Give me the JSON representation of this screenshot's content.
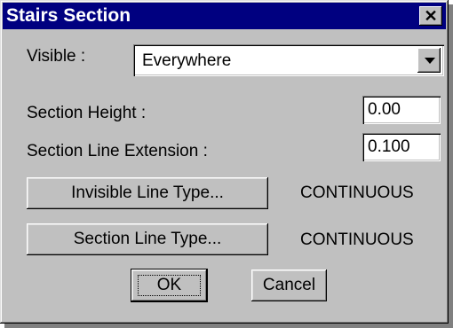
{
  "dialog": {
    "title": "Stairs Section",
    "close_glyph": "✕"
  },
  "visible": {
    "label": "Visible :",
    "value": "Everywhere"
  },
  "section_height": {
    "label": "Section Height :",
    "value": "0.00"
  },
  "section_line_extension": {
    "label": "Section Line Extension :",
    "value": "0.100"
  },
  "invisible_line_type": {
    "button_label": "Invisible Line Type...",
    "value": "CONTINUOUS"
  },
  "section_line_type": {
    "button_label": "Section Line Type...",
    "value": "CONTINUOUS"
  },
  "actions": {
    "ok_label": "OK",
    "cancel_label": "Cancel"
  },
  "icons": {
    "close": "close-icon",
    "dropdown": "chevron-down-icon"
  },
  "colors": {
    "titlebar": "#000080",
    "face": "#c0c0c0"
  }
}
